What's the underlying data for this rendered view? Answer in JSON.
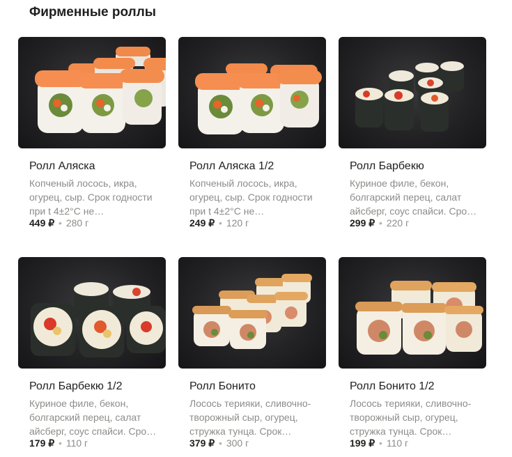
{
  "section": {
    "title": "Фирменные роллы"
  },
  "products": [
    {
      "name": "Ролл Аляска",
      "description": "Копченый лосось, икра, огурец, сыр. Срок годности при t 4±2°C не…",
      "price": "449 ₽",
      "separator": "•",
      "weight": "280 г",
      "image_icon": "salmon-roll-photo-icon"
    },
    {
      "name": "Ролл Аляска 1/2",
      "description": "Копченый лосось, икра, огурец, сыр. Срок годности при t 4±2°C не…",
      "price": "249 ₽",
      "separator": "•",
      "weight": "120 г",
      "image_icon": "salmon-roll-photo-icon"
    },
    {
      "name": "Ролл Барбекю",
      "description": "Куриное филе, бекон, болгарский перец, салат айсберг, соус спайси. Сро…",
      "price": "299 ₽",
      "separator": "•",
      "weight": "220 г",
      "image_icon": "nori-roll-photo-icon"
    },
    {
      "name": "Ролл Барбекю 1/2",
      "description": "Куриное филе, бекон, болгарский перец, салат айсберг, соус спайси. Сро…",
      "price": "179 ₽",
      "separator": "•",
      "weight": "110 г",
      "image_icon": "nori-roll-photo-icon"
    },
    {
      "name": "Ролл Бонито",
      "description": "Лосось терияки, сливочно-творожный сыр, огурец, стружка тунца. Срок…",
      "price": "379 ₽",
      "separator": "•",
      "weight": "300 г",
      "image_icon": "bonito-roll-photo-icon"
    },
    {
      "name": "Ролл Бонито 1/2",
      "description": "Лосось терияки, сливочно-творожный сыр, огурец, стружка тунца. Срок…",
      "price": "199 ₽",
      "separator": "•",
      "weight": "110 г",
      "image_icon": "bonito-roll-photo-icon"
    }
  ],
  "colors": {
    "text_primary": "#21201f",
    "text_secondary": "#8d8c8a",
    "photo_background": "#232325",
    "salmon": "#f08a4b",
    "nori": "#2b2f2b",
    "rice": "#f4f1ea"
  }
}
